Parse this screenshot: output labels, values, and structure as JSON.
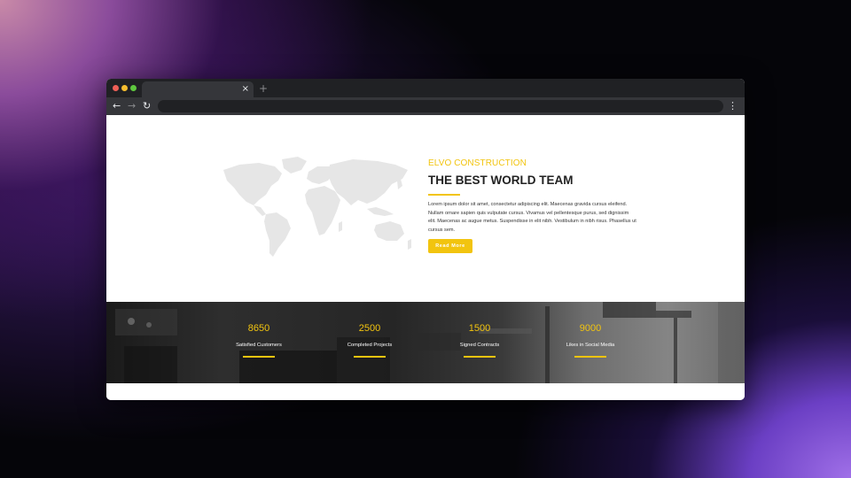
{
  "browser": {
    "tab_close": "×",
    "new_tab": "+",
    "back": "←",
    "forward": "→",
    "reload": "↻",
    "menu": "⋮",
    "address": ""
  },
  "about": {
    "brand": "ELVO CONSTRUCTION",
    "title": "THE BEST WORLD TEAM",
    "paragraph": "Lorem ipsum dolor sit amet, consectetur adipiscing elit. Maecenas gravida cursus eleifend. Nullam ornare sapien quis vulputate cursus. Vivamus vel pellentesque purus, sed dignissim elit. Maecenas ac augue metus. Suspendisse in elit nibh. Vestibulum in nibh risus. Phasellus ut cursus sem.",
    "button": "Read More"
  },
  "stats": [
    {
      "value": "8650",
      "label": "Satisfied Customers"
    },
    {
      "value": "2500",
      "label": "Completed Projects"
    },
    {
      "value": "1500",
      "label": "Signed Contracts"
    },
    {
      "value": "9000",
      "label": "Likes in Social Media"
    }
  ],
  "colors": {
    "accent": "#f2c40f",
    "map": "#e6e6e6",
    "chrome_dark": "#202124",
    "chrome_mid": "#35363a"
  }
}
